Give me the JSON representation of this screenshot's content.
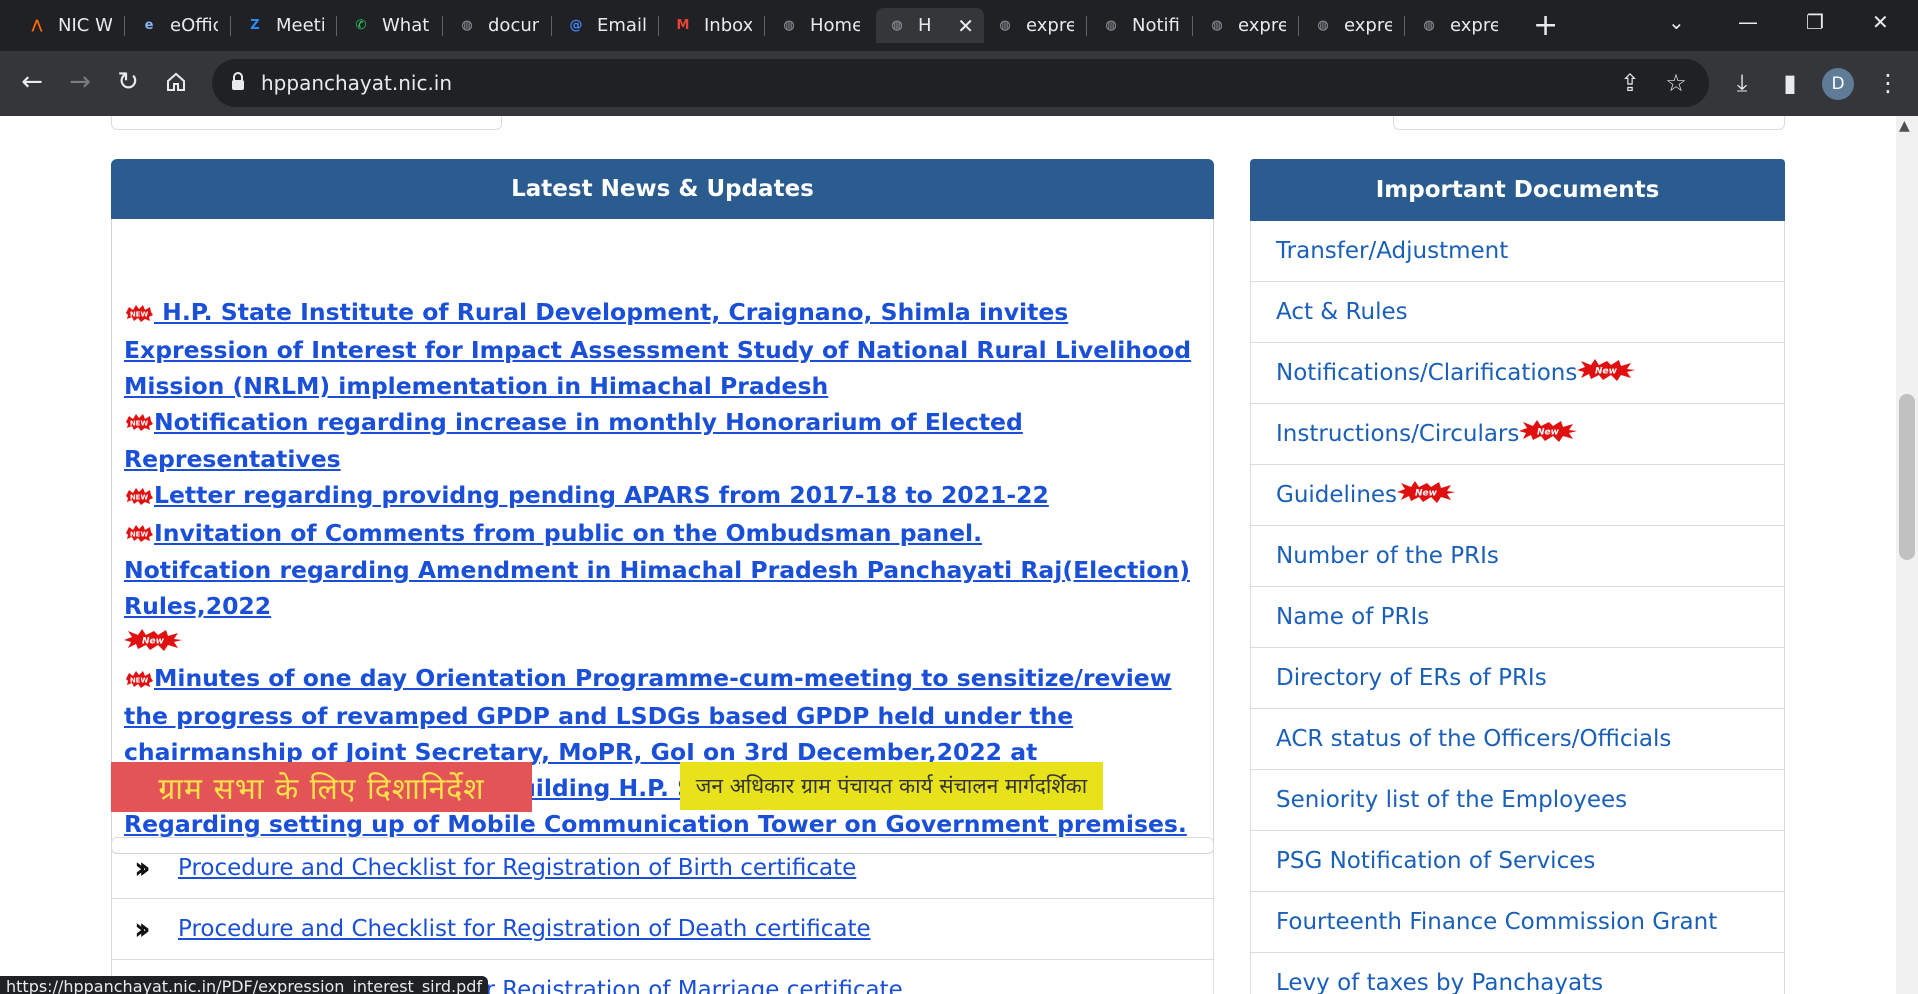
{
  "browser": {
    "tabs": [
      {
        "title": "NIC W",
        "icon": "nic-icon",
        "color": "#ff6d00"
      },
      {
        "title": "eOffic",
        "icon": "eoffice-icon",
        "color": "#8ab4f8"
      },
      {
        "title": "Meeti",
        "icon": "zoom-icon",
        "color": "#2d8cff"
      },
      {
        "title": "Whats",
        "icon": "whatsapp-icon",
        "color": "#25d366"
      },
      {
        "title": "docun",
        "icon": "globe-icon",
        "color": "#9aa0a6"
      },
      {
        "title": "Email",
        "icon": "email-icon",
        "color": "#4285f4"
      },
      {
        "title": "Inbox",
        "icon": "gmail-icon",
        "color": "#ea4335"
      },
      {
        "title": "Home",
        "icon": "globe-icon",
        "color": "#9aa0a6"
      },
      {
        "title": "H",
        "icon": "globe-icon",
        "color": "#9aa0a6",
        "active": true
      },
      {
        "title": "expre",
        "icon": "globe-icon",
        "color": "#9aa0a6"
      },
      {
        "title": "Notifi",
        "icon": "globe-icon",
        "color": "#9aa0a6"
      },
      {
        "title": "expre",
        "icon": "globe-icon",
        "color": "#9aa0a6"
      },
      {
        "title": "expre",
        "icon": "globe-icon",
        "color": "#9aa0a6"
      },
      {
        "title": "expre",
        "icon": "globe-icon",
        "color": "#9aa0a6"
      }
    ],
    "url": "hppanchayat.nic.in",
    "profile_initial": "D",
    "status_url": "https://hppanchayat.nic.in/PDF/expression_interest_sird.pdf"
  },
  "news": {
    "heading": "Latest News & Updates",
    "items": [
      {
        "text": " H.P. State Institute of Rural Development, Craignano, Shimla invites Expression of Interest for Impact Assessment Study of National Rural Livelihood Mission (NRLM) implementation in Himachal Pradesh",
        "badge": "new-oval"
      },
      {
        "text": "Notification regarding increase in monthly Honorarium of Elected Representatives",
        "badge": "new-oval"
      },
      {
        "text": "Letter regarding providng pending APARS from 2017-18 to 2021-22",
        "badge": "new-oval"
      },
      {
        "text": "Invitation of Comments from public on the Ombudsman panel.",
        "badge": "new-oval"
      },
      {
        "text": "Notifcation regarding Amendment in Himachal Pradesh Panchayati Raj(Election) Rules,2022",
        "badge": "new-star-after"
      },
      {
        "text": "Minutes of one day Orientation Programme-cum-meeting to sensitize/review the progress of revamped GPDP and LSDGs based GPDP held under the chairmanship of Joint Secretary, MoPR, GoI on 3rd December,2022 at Connference Hall, Armsdale Building H.P. Secretariat.",
        "badge": "new-oval"
      },
      {
        "text": "Regarding setting up of Mobile Communication Tower on Government premises.",
        "badge": "none"
      }
    ],
    "badge_text_oval": "NEW",
    "badge_text_star": "New"
  },
  "banners": {
    "red": "ग्राम सभा के लिए दिशानिर्देश",
    "yellow": "जन अधिकार ग्राम पंचायत कार्य संचालन मार्गदर्शिका"
  },
  "procedures": [
    "Procedure and Checklist for Registration of Birth certificate",
    "Procedure and Checklist for Registration of Death certificate",
    "Procedure and Checklist for Registration of Marriage certificate"
  ],
  "documents": {
    "heading": "Important Documents",
    "items": [
      {
        "label": "Transfer/Adjustment",
        "new": false
      },
      {
        "label": "Act & Rules",
        "new": false
      },
      {
        "label": "Notifications/Clarifications",
        "new": true
      },
      {
        "label": "Instructions/Circulars",
        "new": true
      },
      {
        "label": "Guidelines",
        "new": true
      },
      {
        "label": "Number of the PRIs",
        "new": false
      },
      {
        "label": "Name of PRIs",
        "new": false
      },
      {
        "label": "Directory of ERs of PRIs",
        "new": false
      },
      {
        "label": "ACR status of the Officers/Officials",
        "new": false
      },
      {
        "label": "Seniority list of the Employees",
        "new": false
      },
      {
        "label": "PSG Notification of Services",
        "new": false
      },
      {
        "label": "Fourteenth Finance Commission Grant",
        "new": false
      },
      {
        "label": "Levy of taxes by Panchayats",
        "new": false
      }
    ]
  },
  "colors": {
    "panel_header": "#2b5c8f",
    "link": "#1a4fd8",
    "badge_red": "#e01010",
    "banner_red": "#e35456",
    "banner_yellow": "#e8e21a"
  }
}
